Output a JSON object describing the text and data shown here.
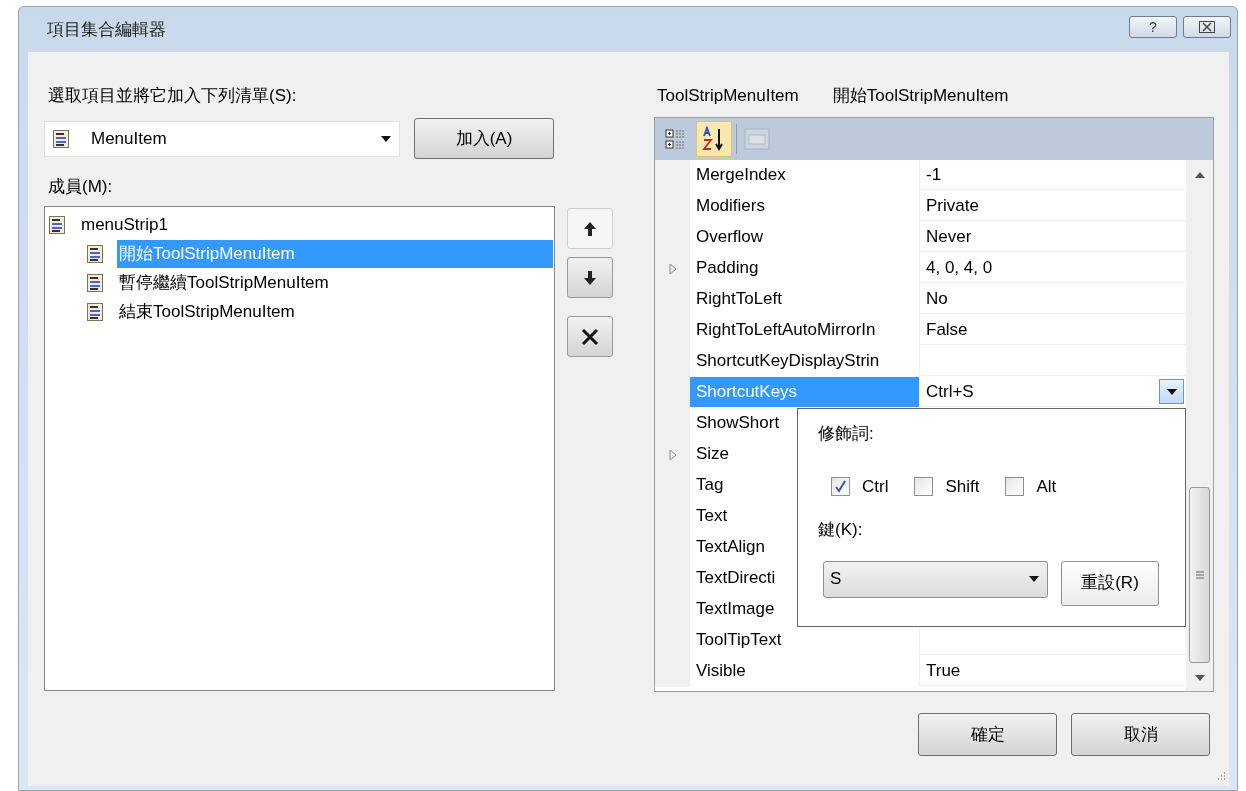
{
  "window": {
    "title": "項目集合編輯器",
    "help_button": "?"
  },
  "add_panel": {
    "label": "選取項目並將它加入下列清單(S):",
    "combo_value": "MenuItem",
    "add_button": "加入(A)"
  },
  "members": {
    "label": "成員(M):",
    "tree": [
      {
        "label": "menuStrip1",
        "selected": false,
        "children": [
          {
            "label": "開始ToolStripMenuItem",
            "selected": true
          },
          {
            "label": "暫停繼續ToolStripMenuItem",
            "selected": false
          },
          {
            "label": "結束ToolStripMenuItem",
            "selected": false
          }
        ]
      }
    ]
  },
  "move_buttons": [
    {
      "kind": "up"
    },
    {
      "kind": "down"
    },
    {
      "kind": "remove"
    }
  ],
  "properties": {
    "type_name": "ToolStripMenuItem",
    "object_name": "開始ToolStripMenuItem",
    "toolbar": [
      {
        "kind": "categorized",
        "selected": false,
        "disabled": false
      },
      {
        "kind": "alphabetical",
        "selected": true,
        "disabled": false
      },
      {
        "kind": "property_pages",
        "selected": false,
        "disabled": true
      }
    ],
    "rows": [
      {
        "name": "MergeIndex",
        "value": "-1",
        "expandable": false,
        "selected": false
      },
      {
        "name": "Modifiers",
        "value": "Private",
        "expandable": false,
        "selected": false
      },
      {
        "name": "Overflow",
        "value": "Never",
        "expandable": false,
        "selected": false
      },
      {
        "name": "Padding",
        "value": "4, 0, 4, 0",
        "expandable": true,
        "selected": false
      },
      {
        "name": "RightToLeft",
        "value": "No",
        "expandable": false,
        "selected": false
      },
      {
        "name": "RightToLeftAutoMirrorIn",
        "value": "False",
        "expandable": false,
        "selected": false
      },
      {
        "name": "ShortcutKeyDisplayStrin",
        "expandable": false,
        "selected": false
      },
      {
        "name": "ShortcutKeys",
        "value": "Ctrl+S",
        "expandable": false,
        "selected": true
      },
      {
        "name": "ShowShort",
        "expandable": false,
        "selected": false
      },
      {
        "name": "Size",
        "expandable": true,
        "selected": false
      },
      {
        "name": "Tag",
        "expandable": false,
        "selected": false
      },
      {
        "name": "Text",
        "expandable": false,
        "selected": false
      },
      {
        "name": "TextAlign",
        "expandable": false,
        "selected": false
      },
      {
        "name": "TextDirecti",
        "expandable": false,
        "selected": false
      },
      {
        "name": "TextImage",
        "expandable": false,
        "selected": false
      },
      {
        "name": "ToolTipText",
        "expandable": false,
        "selected": false
      },
      {
        "name": "Visible",
        "value": "True",
        "expandable": false,
        "selected": false
      }
    ]
  },
  "shortcut_popup": {
    "modifiers_label": "修飾詞:",
    "modifiers": [
      {
        "label": "Ctrl",
        "checked": true
      },
      {
        "label": "Shift",
        "checked": false
      },
      {
        "label": "Alt",
        "checked": false
      }
    ],
    "key_label": "鍵(K):",
    "key_value": "S",
    "reset_button": "重設(R)"
  },
  "buttons": [
    "確定",
    "取消"
  ]
}
